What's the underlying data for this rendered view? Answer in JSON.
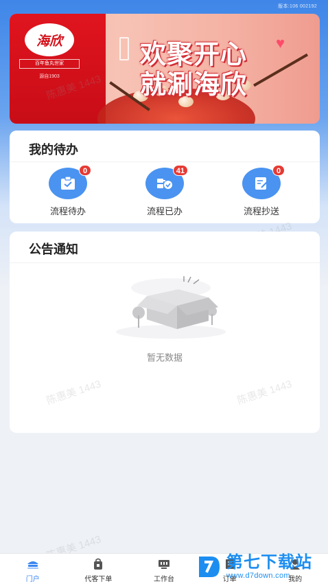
{
  "status_bar": {
    "text": "版本:106 002192"
  },
  "banner": {
    "brand_logo": "海欣",
    "brand_tag": "百年鱼丸世家",
    "brand_since": "源自1903",
    "slogan_line1": "欢聚开心",
    "slogan_line2": "就涮海欣"
  },
  "watermark_text": "陈惠美 1443",
  "todo": {
    "title": "我的待办",
    "items": [
      {
        "label": "流程待办",
        "count": "0",
        "icon": "clipboard-check-icon"
      },
      {
        "label": "流程已办",
        "count": "41",
        "icon": "process-done-icon"
      },
      {
        "label": "流程抄送",
        "count": "0",
        "icon": "document-edit-icon"
      }
    ]
  },
  "notice": {
    "title": "公告通知",
    "empty_text": "暂无数据"
  },
  "tabbar": {
    "items": [
      {
        "label": "门户",
        "icon": "home-icon",
        "active": true
      },
      {
        "label": "代客下单",
        "icon": "bag-icon",
        "active": false
      },
      {
        "label": "工作台",
        "icon": "workbench-icon",
        "active": false
      },
      {
        "label": "订单",
        "icon": "order-icon",
        "active": false
      },
      {
        "label": "我的",
        "icon": "user-icon",
        "active": false
      }
    ]
  },
  "overlay_brand": {
    "name": "第七下载站",
    "url": "www.d7down.com"
  },
  "colors": {
    "primary": "#3a86f0",
    "badge": "#e63a34",
    "brand_red": "#d4101a"
  }
}
